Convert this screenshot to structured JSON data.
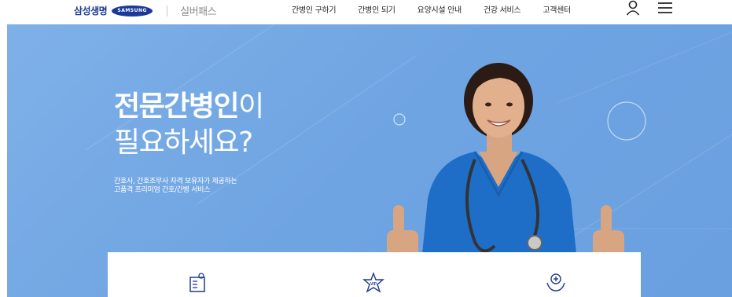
{
  "header": {
    "brand_name": "삼성생명",
    "samsung_logo_text": "SAMSUNG",
    "brand_sub": "실버패스",
    "nav": [
      "간병인 구하기",
      "간병인 되기",
      "요양시설 안내",
      "건강 서비스",
      "고객센터"
    ]
  },
  "hero": {
    "title_strong": "전문간병인",
    "title_light_1": "이",
    "title_line2": "필요하세요?",
    "desc_line1": "간호사, 간호조무사 자격 보유자가 제공하는",
    "desc_line2": "고품격 프리미엄 간호/간병 서비스",
    "bg_color": "#6ea4e2"
  },
  "cards": {
    "icons": [
      "document-icon",
      "vip-star-icon",
      "care-hands-icon"
    ],
    "icon_color": "#1d3b8f"
  }
}
